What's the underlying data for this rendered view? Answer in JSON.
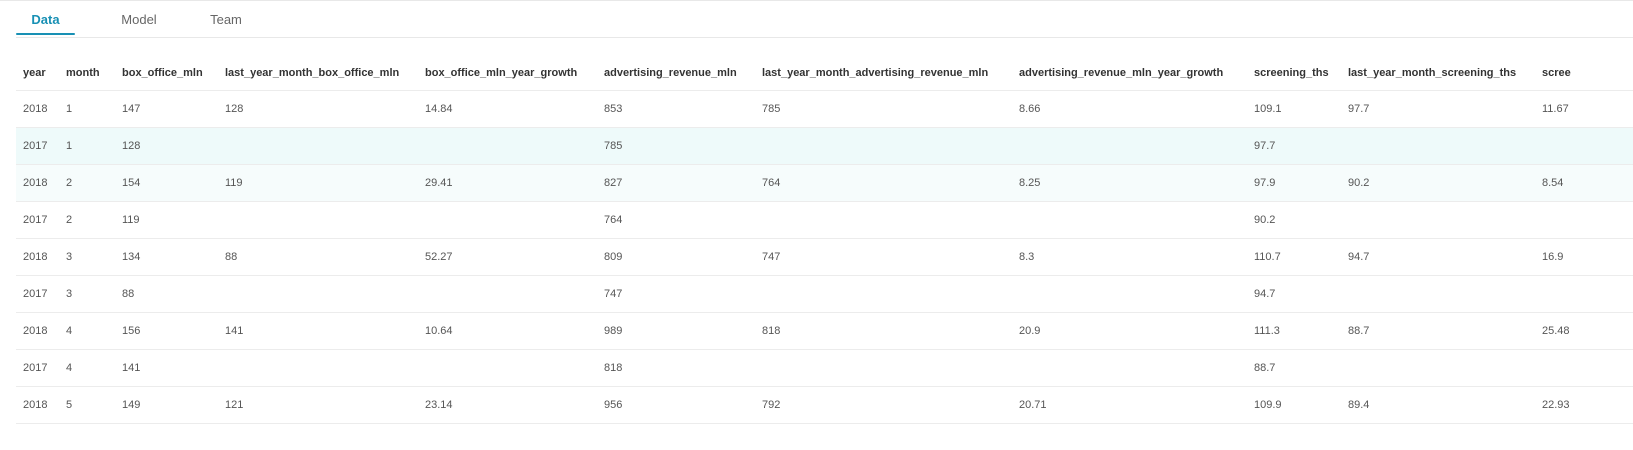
{
  "tabs": [
    {
      "label": "Data",
      "active": true
    },
    {
      "label": "Model",
      "active": false
    },
    {
      "label": "Team",
      "active": false
    }
  ],
  "colors": {
    "accent": "#1890b4",
    "row_highlight": "#eefafa"
  },
  "table": {
    "columns": [
      "year",
      "month",
      "box_office_mln",
      "last_year_month_box_office_mln",
      "box_office_mln_year_growth",
      "advertising_revenue_mln",
      "last_year_month_advertising_revenue_mln",
      "advertising_revenue_mln_year_growth",
      "screening_ths",
      "last_year_month_screening_ths",
      "scree"
    ],
    "rows": [
      [
        "2018",
        "1",
        "147",
        "128",
        "14.84",
        "853",
        "785",
        "8.66",
        "109.1",
        "97.7",
        "11.67"
      ],
      [
        "2017",
        "1",
        "128",
        "",
        "",
        "785",
        "",
        "",
        "97.7",
        "",
        ""
      ],
      [
        "2018",
        "2",
        "154",
        "119",
        "29.41",
        "827",
        "764",
        "8.25",
        "97.9",
        "90.2",
        "8.54"
      ],
      [
        "2017",
        "2",
        "119",
        "",
        "",
        "764",
        "",
        "",
        "90.2",
        "",
        ""
      ],
      [
        "2018",
        "3",
        "134",
        "88",
        "52.27",
        "809",
        "747",
        "8.3",
        "110.7",
        "94.7",
        "16.9"
      ],
      [
        "2017",
        "3",
        "88",
        "",
        "",
        "747",
        "",
        "",
        "94.7",
        "",
        ""
      ],
      [
        "2018",
        "4",
        "156",
        "141",
        "10.64",
        "989",
        "818",
        "20.9",
        "111.3",
        "88.7",
        "25.48"
      ],
      [
        "2017",
        "4",
        "141",
        "",
        "",
        "818",
        "",
        "",
        "88.7",
        "",
        ""
      ],
      [
        "2018",
        "5",
        "149",
        "121",
        "23.14",
        "956",
        "792",
        "20.71",
        "109.9",
        "89.4",
        "22.93"
      ]
    ]
  }
}
